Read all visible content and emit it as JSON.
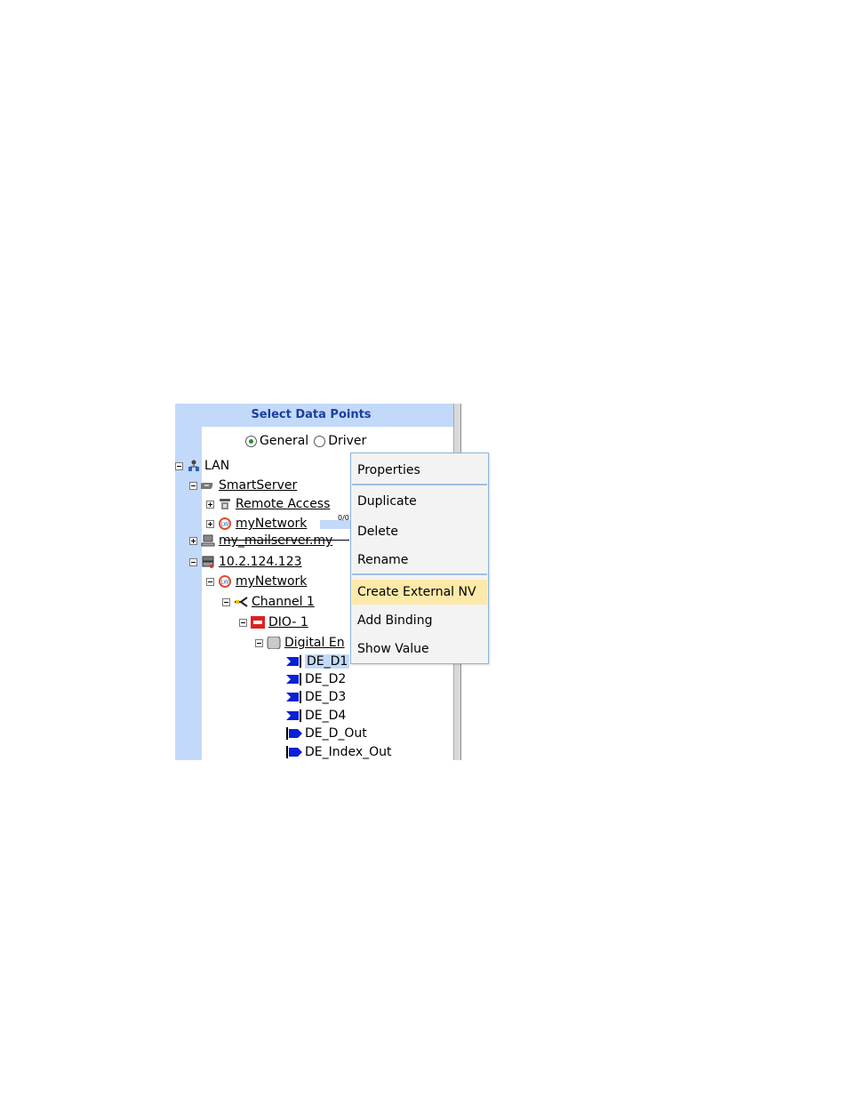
{
  "panel": {
    "title": "Select Data Points",
    "mode": {
      "options": [
        "General",
        "Driver"
      ],
      "selected": "General"
    }
  },
  "tree": [
    {
      "label": "LAN",
      "icon": "lan-icon",
      "expanded": true,
      "link": false
    },
    {
      "label": "SmartServer",
      "icon": "smartserver-icon",
      "expanded": true,
      "link": true
    },
    {
      "label": "Remote Access",
      "icon": "phone-icon",
      "expanded": false,
      "link": true
    },
    {
      "label": "myNetwork",
      "icon": "network-icon",
      "expanded": false,
      "link": true,
      "progress_text": "0/0"
    },
    {
      "label": "my_mailserver.my",
      "icon": "computer-icon",
      "expanded": false,
      "link": true
    },
    {
      "label": "10.2.124.123",
      "icon": "server-icon",
      "expanded": true,
      "link": true
    },
    {
      "label": "myNetwork",
      "icon": "network-icon",
      "expanded": true,
      "link": true
    },
    {
      "label": "Channel 1",
      "icon": "channel-icon",
      "expanded": true,
      "link": true
    },
    {
      "label": "DIO- 1",
      "icon": "device-icon",
      "expanded": true,
      "link": true
    },
    {
      "label": "Digital En",
      "icon": "functional-block-icon",
      "expanded": true,
      "link": true
    },
    {
      "label": "DE_D1",
      "icon": "input-datapoint-icon",
      "selected": true
    },
    {
      "label": "DE_D2",
      "icon": "input-datapoint-icon"
    },
    {
      "label": "DE_D3",
      "icon": "input-datapoint-icon"
    },
    {
      "label": "DE_D4",
      "icon": "input-datapoint-icon"
    },
    {
      "label": "DE_D_Out",
      "icon": "output-datapoint-icon"
    },
    {
      "label": "DE_Index_Out",
      "icon": "output-datapoint-icon"
    }
  ],
  "context_menu": {
    "items": [
      {
        "label": "Properties"
      },
      {
        "label": "Duplicate"
      },
      {
        "label": "Delete"
      },
      {
        "label": "Rename"
      },
      {
        "label": "Create External NV",
        "highlighted": true
      },
      {
        "label": "Add Binding"
      },
      {
        "label": "Show Value"
      }
    ]
  },
  "colors": {
    "panel_bg": "#c2d9fa",
    "title": "#1c3ea0",
    "menu_highlight": "#fde9a9",
    "menu_border": "#8ab2e0",
    "datapoint_icon": "#0a1fd6"
  }
}
